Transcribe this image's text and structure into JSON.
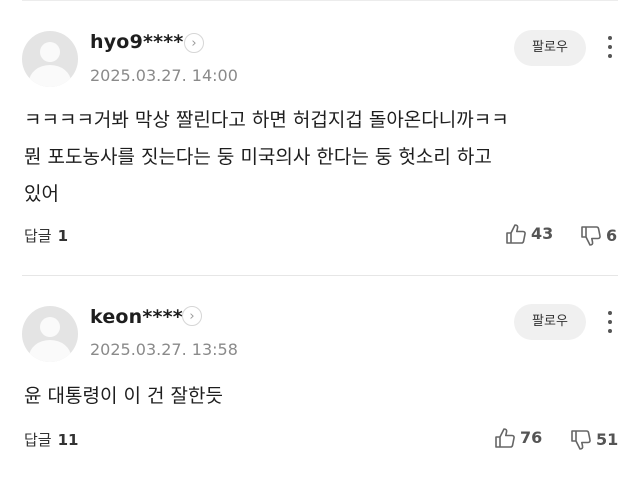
{
  "comments": [
    {
      "nickname": "hyo9****",
      "date": "2025.03.27. 14:00",
      "follow_label": "팔로우",
      "lines": [
        "ㅋㅋㅋㅋ거봐 막상 짤린다고 하면 허겁지겁 돌아온다니까ㅋㅋ",
        "뭔 포도농사를 짓는다는 둥 미국의사 한다는 둥 헛소리 하고",
        "있어"
      ],
      "reply_label": "답글",
      "reply_count": "1",
      "likes": "43",
      "dislikes": "6"
    },
    {
      "nickname": "keon****",
      "date": "2025.03.27. 13:58",
      "follow_label": "팔로우",
      "lines": [
        "윤 대통령이 이 건 잘한듯"
      ],
      "reply_label": "답글",
      "reply_count": "11",
      "likes": "76",
      "dislikes": "51"
    }
  ],
  "icons": {
    "avatar": "default-profile-icon",
    "profile_link": "chevron-right-icon",
    "more": "kebab-menu-icon",
    "like": "thumbs-up-icon",
    "dislike": "thumbs-down-icon"
  },
  "colors": {
    "text": "#1e1e1e",
    "muted": "#8a8a8a",
    "button_bg": "#f0f0f0"
  }
}
